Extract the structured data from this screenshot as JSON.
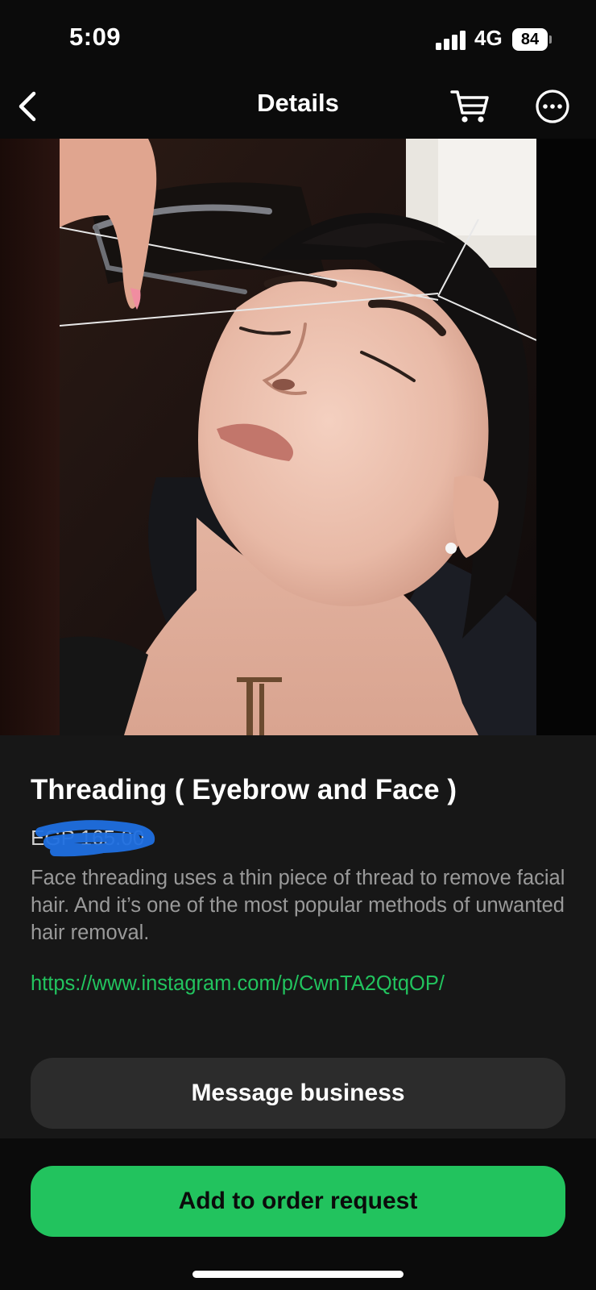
{
  "status_bar": {
    "time": "5:09",
    "network": "4G",
    "battery": "84"
  },
  "header": {
    "title": "Details",
    "icons": {
      "back": "chevron-left-icon",
      "cart": "cart-icon",
      "more": "more-icon"
    }
  },
  "product": {
    "title": "Threading ( Eyebrow and Face )",
    "price": "EGP 165.00",
    "description": "Face threading uses a thin piece of thread to remove facial hair. And it’s one of the most popular methods of unwanted hair removal.",
    "link": "https://www.instagram.com/p/CwnTA2QtqOP/"
  },
  "actions": {
    "message_label": "Message business",
    "order_label": "Add to order request"
  },
  "colors": {
    "accent": "#22c35e",
    "background": "#0b0b0b",
    "panel": "#171717",
    "secondary_button": "#2c2c2c",
    "redaction": "#1f6fe0"
  }
}
